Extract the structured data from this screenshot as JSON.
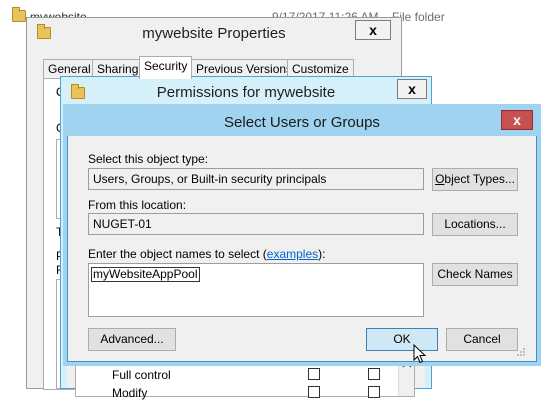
{
  "explorer": {
    "name": "mywebsite",
    "date": "9/17/2017 11:26 AM",
    "type": "File folder"
  },
  "properties": {
    "title": "mywebsite Properties",
    "close": "x",
    "tabs": [
      "General",
      "Sharing",
      "Security",
      "Previous Versions",
      "Customize"
    ],
    "selected_tab": "Security",
    "side_letters": [
      "O",
      "G",
      "T",
      "P",
      "F"
    ]
  },
  "permissions": {
    "title": "Permissions for mywebsite",
    "close": "x",
    "rows": [
      "Full control",
      "Modify"
    ]
  },
  "select_users": {
    "title": "Select Users or Groups",
    "close": "x",
    "object_type_label": "Select this object type:",
    "object_type_value": "Users, Groups, or Built-in security principals",
    "object_types_button": "Object Types...",
    "location_label": "From this location:",
    "location_value": "NUGET-01",
    "locations_button": "Locations...",
    "names_label_prefix": "Enter the object names to select (",
    "names_label_link": "examples",
    "names_label_suffix": "):",
    "names_value": "myWebsiteAppPool",
    "check_names_button": "Check Names",
    "advanced_button": "Advanced...",
    "ok_button": "OK",
    "cancel_button": "Cancel"
  },
  "colors": {
    "dialog_titlebar": "#9fd3ef",
    "close_red": "#c75050",
    "link": "#0066cc"
  }
}
